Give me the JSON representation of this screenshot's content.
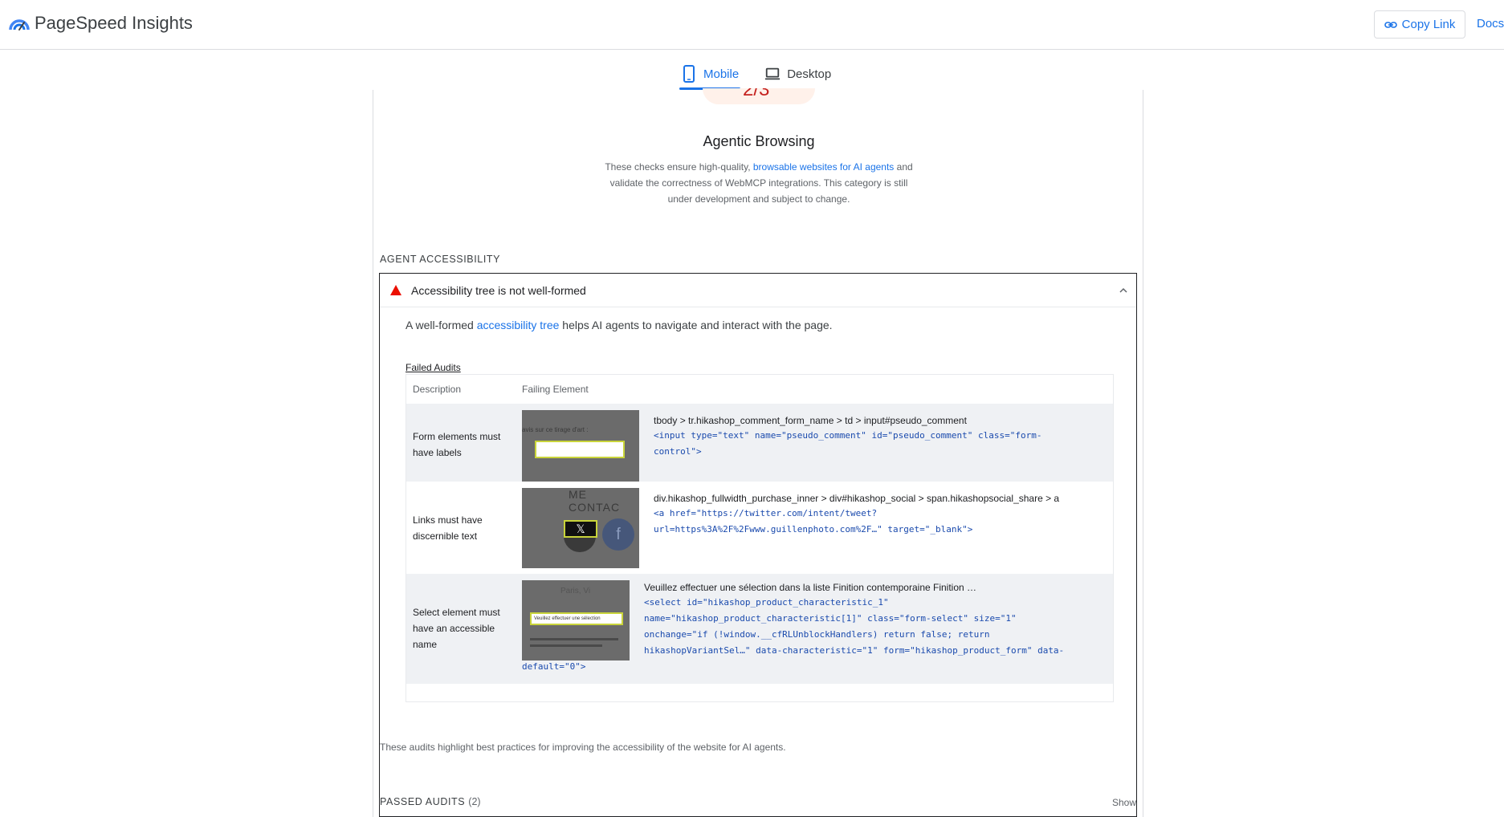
{
  "header": {
    "brand": "PageSpeed Insights",
    "copy_link": "Copy Link",
    "docs": "Docs"
  },
  "tabs": [
    {
      "label": "Mobile",
      "icon": "phone-icon",
      "active": true
    },
    {
      "label": "Desktop",
      "icon": "laptop-icon",
      "active": false
    }
  ],
  "gauge": {
    "partial_text": "2/3"
  },
  "category": {
    "title": "Agentic Browsing",
    "desc_before": "These checks ensure high-quality, ",
    "desc_link": "browsable websites for AI agents",
    "desc_after": " and validate the correctness of WebMCP integrations. This category is still under development and subject to change."
  },
  "group": {
    "title": "AGENT ACCESSIBILITY",
    "footer": "These audits highlight best practices for improving the accessibility of the website for AI agents."
  },
  "audit": {
    "title": "Accessibility tree is not well-formed",
    "desc_before": "A well-formed ",
    "desc_link": "accessibility tree",
    "desc_after": " helps AI agents to navigate and interact with the page.",
    "failed_label": "Failed Audits",
    "col_description": "Description",
    "col_element": "Failing Element",
    "rows": [
      {
        "description": "Form elements must have labels",
        "path": "tbody > tr.hikashop_comment_form_name > td > input#pseudo_comment",
        "snippet_lines": [
          "<input type=\"text\" name=\"pseudo_comment\" id=\"pseudo_comment\" class=\"form-",
          "control\">"
        ],
        "shot_text": "avis sur ce tirage d'art :"
      },
      {
        "description": "Links must have discernible text",
        "path": "div.hikashop_fullwidth_purchase_inner > div#hikashop_social > span.hikashopsocial_share > a",
        "snippet_lines": [
          "<a href=\"https://twitter.com/intent/tweet?",
          "url=https%3A%2F%2Fwww.guillenphoto.com%2F…\" target=\"_blank\">"
        ],
        "shot_text": "ME CONTAC"
      },
      {
        "description": "Select element must have an accessible name",
        "path": "Veuillez effectuer une sélection dans la liste Finition contemporaine Finition …",
        "snippet_lines": [
          "<select id=\"hikashop_product_characteristic_1\"",
          "name=\"hikashop_product_characteristic[1]\" class=\"form-select\" size=\"1\"",
          "onchange=\"if (!window.__cfRLUnblockHandlers) return false; return",
          "hikashopVariantSel…\" data-characteristic=\"1\" form=\"hikashop_product_form\" data-"
        ],
        "snippet_tail": "default=\"0\">",
        "shot_text": "Veuillez effectuer une sélection"
      }
    ]
  },
  "passed": {
    "label": "PASSED AUDITS",
    "count": "(2)",
    "show": "Show"
  },
  "colors": {
    "accent": "#1a73e8",
    "fail": "#eb0f00",
    "row_alt": "#eff1f4"
  }
}
